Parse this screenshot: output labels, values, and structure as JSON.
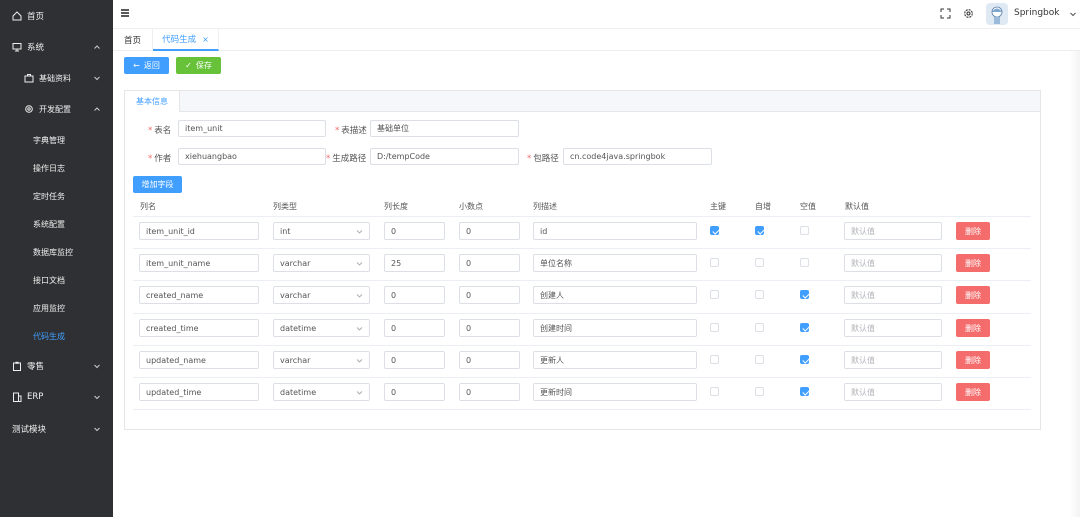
{
  "sidebar": {
    "items": [
      {
        "label": "首页",
        "icon": "home-icon"
      },
      {
        "label": "系统",
        "icon": "monitor-icon"
      },
      {
        "label": "基础资料",
        "icon": "briefcase-icon"
      },
      {
        "label": "开发配置",
        "icon": "gear-icon"
      },
      {
        "label": "字典管理"
      },
      {
        "label": "操作日志"
      },
      {
        "label": "定时任务"
      },
      {
        "label": "系统配置"
      },
      {
        "label": "数据库监控"
      },
      {
        "label": "接口文档"
      },
      {
        "label": "应用监控"
      },
      {
        "label": "代码生成"
      },
      {
        "label": "零售",
        "icon": "clipboard-icon"
      },
      {
        "label": "ERP",
        "icon": "building-icon"
      },
      {
        "label": "测试模块"
      }
    ]
  },
  "header": {
    "username": "Springbok"
  },
  "tabs": [
    {
      "label": "首页"
    },
    {
      "label": "代码生成",
      "close": "×"
    }
  ],
  "toolbar": {
    "back_label": "返回",
    "save_label": "保存"
  },
  "panel": {
    "tab_label": "基本信息"
  },
  "form": {
    "table_name_label": "表名",
    "table_name": "item_unit",
    "table_desc_label": "表描述",
    "table_desc": "基础单位",
    "author_label": "作者",
    "author": "xiehuangbao",
    "gen_path_label": "生成路径",
    "gen_path": "D:/tempCode",
    "pkg_path_label": "包路径",
    "pkg_path": "cn.code4java.springbok",
    "req_mark": "*"
  },
  "add_column_label": "增加字段",
  "columns_header": {
    "name": "列名",
    "type": "列类型",
    "length": "列长度",
    "decimal": "小数点",
    "desc": "列描述",
    "pk": "主键",
    "auto_inc": "自增",
    "nullable": "空值",
    "default": "默认值"
  },
  "default_placeholder": "默认值",
  "delete_label": "删除",
  "rows": [
    {
      "name": "item_unit_id",
      "type": "int",
      "length": "0",
      "decimal": "0",
      "desc": "id",
      "pk": true,
      "auto_inc": true,
      "nullable": false
    },
    {
      "name": "item_unit_name",
      "type": "varchar",
      "length": "25",
      "decimal": "0",
      "desc": "单位名称",
      "pk": false,
      "auto_inc": false,
      "nullable": false
    },
    {
      "name": "created_name",
      "type": "varchar",
      "length": "0",
      "decimal": "0",
      "desc": "创建人",
      "pk": false,
      "auto_inc": false,
      "nullable": true
    },
    {
      "name": "created_time",
      "type": "datetime",
      "length": "0",
      "decimal": "0",
      "desc": "创建时间",
      "pk": false,
      "auto_inc": false,
      "nullable": true
    },
    {
      "name": "updated_name",
      "type": "varchar",
      "length": "0",
      "decimal": "0",
      "desc": "更新人",
      "pk": false,
      "auto_inc": false,
      "nullable": true
    },
    {
      "name": "updated_time",
      "type": "datetime",
      "length": "0",
      "decimal": "0",
      "desc": "更新时间",
      "pk": false,
      "auto_inc": false,
      "nullable": true
    }
  ],
  "colors": {
    "primary": "#409eff",
    "success": "#67c23a",
    "danger": "#f56c6c",
    "sidebar_bg": "#2f3033"
  }
}
